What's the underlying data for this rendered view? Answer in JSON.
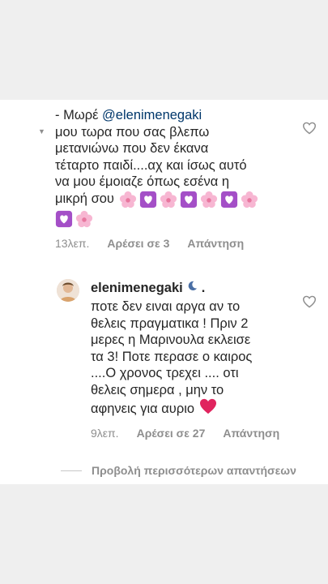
{
  "comment1": {
    "prefix": "- Μωρέ",
    "mention": "@elenimenegaki",
    "lines": [
      "μου τωρα που σας βλεπω",
      "μετανιώνω που δεν έκανα",
      "τέταρτο παιδί....αχ και ίσως αυτό",
      "να μου έμοιαζε όπως εσένα η",
      "μικρή σου"
    ],
    "emoji_line1": [
      "cherry-blossom",
      "heart-purple",
      "cherry-blossom",
      "heart-purple",
      "cherry-blossom",
      "heart-purple",
      "cherry-blossom"
    ],
    "emoji_line2": [
      "heart-purple",
      "cherry-blossom"
    ],
    "time": "13λεπ.",
    "likes": "Αρέσει σε 3",
    "reply": "Απάντηση"
  },
  "comment2": {
    "username": "elenimenegaki",
    "badge_icon": "moon-icon",
    "lines": [
      "ποτε δεν ειναι αργα αν το",
      "θελεις πραγματικα ! Πριν 2",
      "μερες η Μαρινουλα εκλεισε",
      "τα 3! Ποτε περασε ο καιρος",
      "....Ο χρονος τρεχει .... οτι",
      "θελεις σημερα , μην το",
      "αφηνεις για αυριο"
    ],
    "end_emoji": "red-heart",
    "time": "9λεπ.",
    "likes": "Αρέσει σε 27",
    "reply": "Απάντηση"
  },
  "view_more": "Προβολή περισσότερων απαντήσεων",
  "colors": {
    "band": "#efefef",
    "text": "#262626",
    "muted": "#8e8e8e",
    "mention": "#00376b",
    "heart_purple": "#a44fc7",
    "blossom": "#f7b6d2",
    "red_heart": "#e0245e"
  }
}
